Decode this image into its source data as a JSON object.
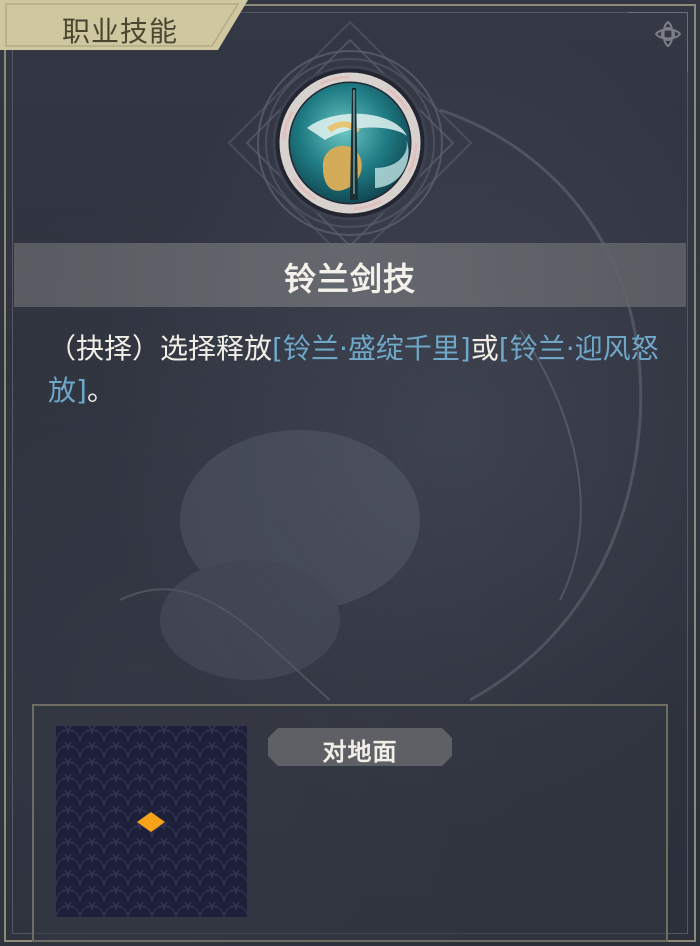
{
  "panel": {
    "tab_title": "职业技能"
  },
  "skill": {
    "icon": "orchid-sword-skill-icon",
    "name": "铃兰剑技",
    "description": {
      "prefix": "（抉择）选择释放",
      "option1": "[铃兰·盛绽千里]",
      "connector": "或",
      "option2": "[铃兰·迎风怒放]",
      "suffix": "。"
    }
  },
  "range": {
    "target_label": "对地面",
    "marker_icon": "diamond-marker-icon"
  },
  "colors": {
    "link": "#6fa7c9",
    "tab_gold": "#cfc79f",
    "marker": "#f7a21b",
    "map_bg": "#1d2038"
  }
}
